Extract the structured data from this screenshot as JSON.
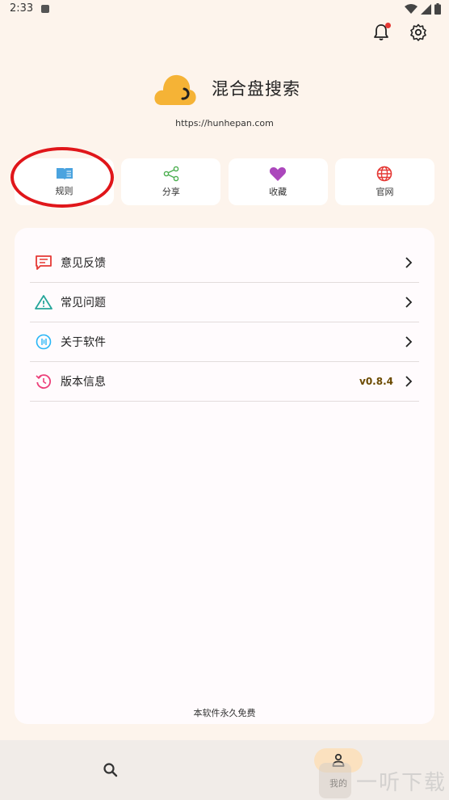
{
  "status_bar": {
    "time": "2:33"
  },
  "top_actions": {
    "notifications_icon": "bell-icon",
    "settings_icon": "gear-icon",
    "has_unread": true
  },
  "brand": {
    "name": "混合盘搜索",
    "url": "https://hunhepan.com",
    "logo_color": "#f5b336"
  },
  "quick_actions": [
    {
      "label": "规则",
      "icon": "book-icon",
      "color": "#4aa3df"
    },
    {
      "label": "分享",
      "icon": "share-icon",
      "color": "#4caf50"
    },
    {
      "label": "收藏",
      "icon": "heart-icon",
      "color": "#ab47bc"
    },
    {
      "label": "官网",
      "icon": "globe-icon",
      "color": "#e53935"
    }
  ],
  "menu": [
    {
      "label": "意见反馈",
      "icon": "message-icon",
      "color": "#e53935"
    },
    {
      "label": "常见问题",
      "icon": "warning-icon",
      "color": "#26a69a"
    },
    {
      "label": "关于软件",
      "icon": "info-circle-icon",
      "color": "#29b6f6"
    },
    {
      "label": "版本信息",
      "icon": "history-icon",
      "color": "#ec407a",
      "value": "v0.8.4"
    }
  ],
  "footer_note": "本软件永久免费",
  "bottom_nav": {
    "search_icon": "search-icon",
    "mine_label": "我的",
    "mine_icon": "person-icon"
  },
  "watermark": {
    "text": "一听下载"
  }
}
